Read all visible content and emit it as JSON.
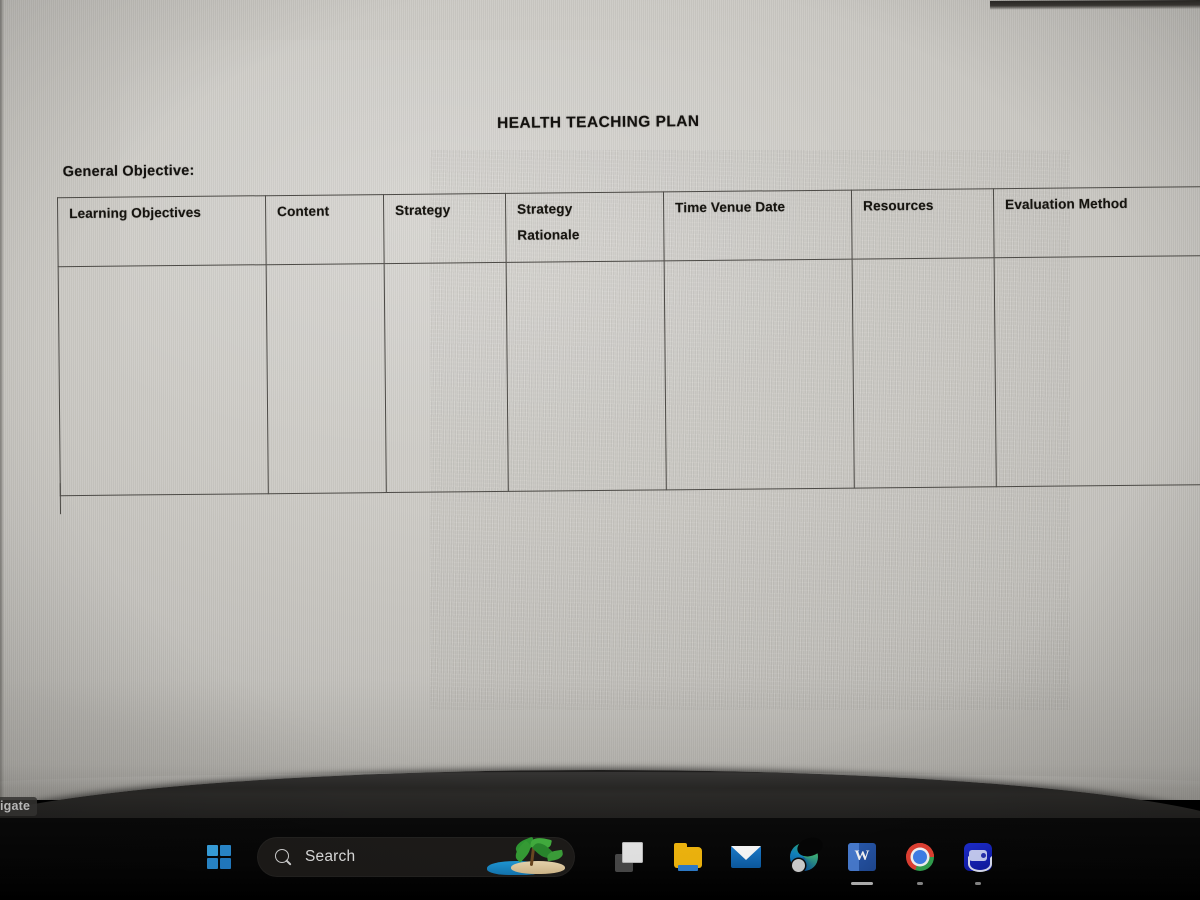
{
  "document": {
    "title": "HEALTH TEACHING PLAN",
    "general_objective_label": "General Objective:",
    "table": {
      "headers": [
        {
          "label": "Learning Objectives"
        },
        {
          "label": "Content"
        },
        {
          "label": "Strategy"
        },
        {
          "label": "Strategy",
          "line2": "Rationale"
        },
        {
          "label": "Time Venue Date"
        },
        {
          "label": "Resources"
        },
        {
          "label": "Evaluation Method"
        }
      ],
      "rows": [
        [
          "",
          "",
          "",
          "",
          "",
          "",
          ""
        ]
      ]
    }
  },
  "monitor": {
    "bezel_label": "igate"
  },
  "taskbar": {
    "start_button": {
      "name": "Start",
      "icon": "windows-logo-icon"
    },
    "search": {
      "placeholder": "Search",
      "icon": "search-icon",
      "thumbnail": "beach-palm-tree-image"
    },
    "apps": [
      {
        "name": "Task View",
        "icon": "task-view-icon",
        "indicator": "none"
      },
      {
        "name": "File Explorer",
        "icon": "file-explorer-icon",
        "indicator": "none"
      },
      {
        "name": "Mail",
        "icon": "mail-icon",
        "indicator": "none"
      },
      {
        "name": "Microsoft Edge",
        "icon": "edge-icon",
        "indicator": "none"
      },
      {
        "name": "Microsoft Word",
        "icon": "word-icon",
        "indicator": "active"
      },
      {
        "name": "Google Chrome",
        "icon": "chrome-icon",
        "indicator": "dot"
      },
      {
        "name": "Messenger",
        "icon": "messenger-icon",
        "indicator": "dot"
      }
    ]
  },
  "colors": {
    "paper": "#cdcbc6",
    "ink": "#14120f",
    "table_border": "#4c4a46",
    "taskbar": "#060606",
    "windows_blue": "#2e9be0"
  }
}
